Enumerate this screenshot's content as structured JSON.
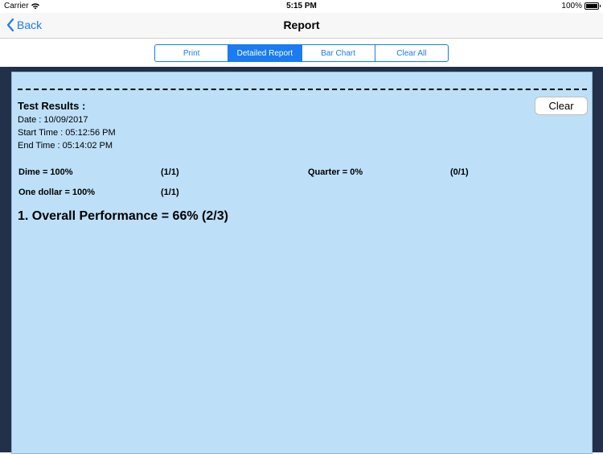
{
  "status_bar": {
    "carrier": "Carrier",
    "time": "5:15 PM",
    "battery": "100%",
    "battery_level": 1.0
  },
  "nav": {
    "back_label": "Back",
    "title": "Report",
    "accent_color": "#1a7bf2"
  },
  "segments": {
    "print": "Print",
    "detailed_report": "Detailed Report",
    "bar_chart": "Bar Chart",
    "clear_all": "Clear All",
    "selected": "Detailed Report"
  },
  "report": {
    "title": "Test Results :",
    "date": "Date : 10/09/2017",
    "start_time": "Start Time : 05:12:56 PM",
    "end_time": "End Time : 05:14:02 PM",
    "clear_label": "Clear",
    "results": [
      {
        "label": "Dime = 100%",
        "ratio": "(1/1)"
      },
      {
        "label": "Quarter = 0%",
        "ratio": "(0/1)"
      },
      {
        "label": "One dollar = 100%",
        "ratio": "(1/1)"
      }
    ],
    "overall": "1. Overall Performance = 66% (2/3)",
    "background_color": "#bde0f8",
    "frame_color": "#23304a"
  }
}
